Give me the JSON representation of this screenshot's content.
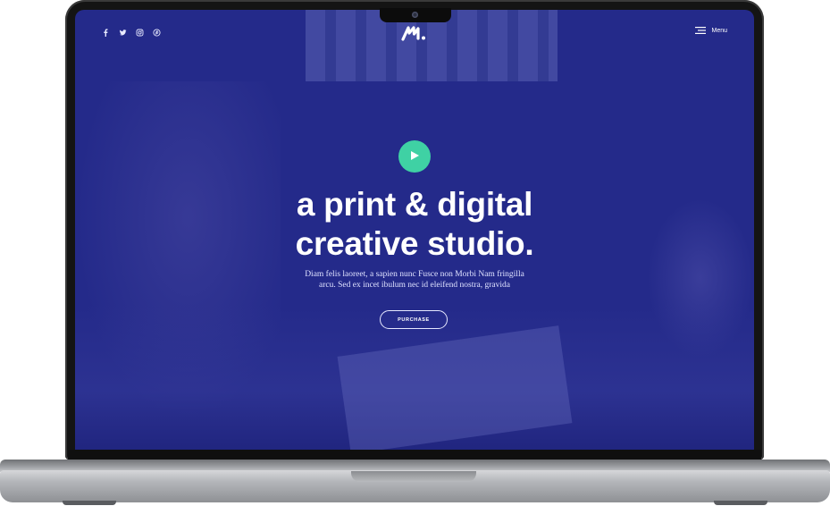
{
  "nav": {
    "social_icons": [
      "facebook-icon",
      "twitter-icon",
      "instagram-icon",
      "pinterest-icon"
    ],
    "menu_label": "Menu"
  },
  "hero": {
    "headline_line1": "a print & digital",
    "headline_line2": "creative studio.",
    "description_line1": "Diam felis laoreet, a sapien nunc Fusce non Morbi Nam fringilla",
    "description_line2": "arcu. Sed ex incet ibulum nec id eleifend nostra, gravida",
    "button_label": "PURCHASE"
  },
  "colors": {
    "screen_background": "#242a8a",
    "play_button": "#3fd1a4",
    "text": "#ffffff"
  }
}
